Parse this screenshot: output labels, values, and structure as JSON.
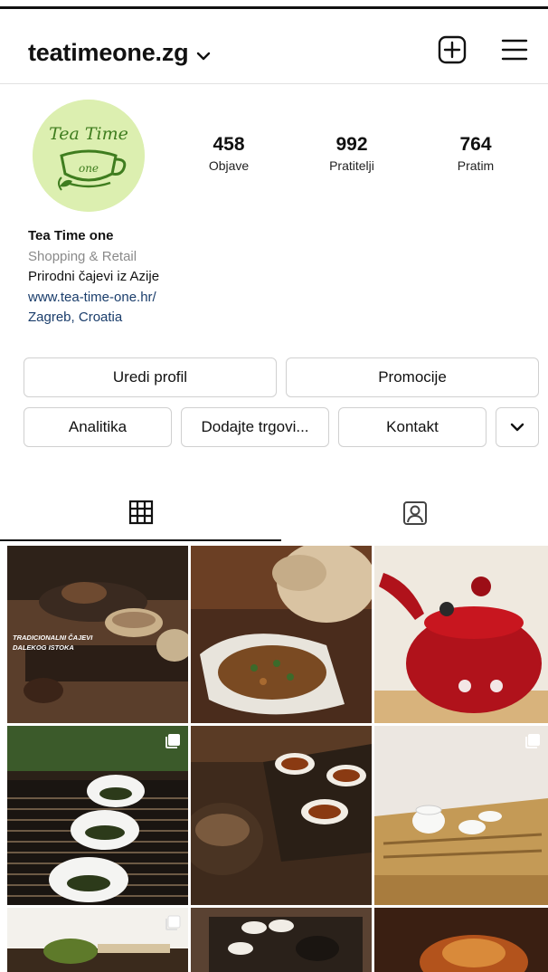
{
  "header": {
    "username": "teatimeone.zg",
    "icons": [
      "chevron-down-icon",
      "new-post-icon",
      "menu-icon"
    ]
  },
  "avatar": {
    "logo_line1": "Tea Time",
    "logo_line2": "one",
    "colors": {
      "bg": "#dcefb0",
      "ink": "#3f7d1f"
    }
  },
  "stats": {
    "posts": {
      "value": "458",
      "label": "Objave"
    },
    "followers": {
      "value": "992",
      "label": "Pratitelji"
    },
    "following": {
      "value": "764",
      "label": "Pratim"
    }
  },
  "bio": {
    "name": "Tea Time one",
    "category": "Shopping & Retail",
    "description": "Prirodni čajevi iz Azije",
    "website": "www.tea-time-one.hr/",
    "location": "Zagreb, Croatia"
  },
  "buttons": {
    "edit_profile": "Uredi profil",
    "promotions": "Promocije",
    "insights": "Analitika",
    "add_shop": "Dodajte trgovi...",
    "contact": "Kontakt"
  },
  "tabs": [
    "grid-icon",
    "tagged-icon"
  ],
  "grid": {
    "post1_caption_line1": "TRADICIONALNI ČAJEVI",
    "post1_caption_line2": "DALEKOG ISTOKA"
  }
}
